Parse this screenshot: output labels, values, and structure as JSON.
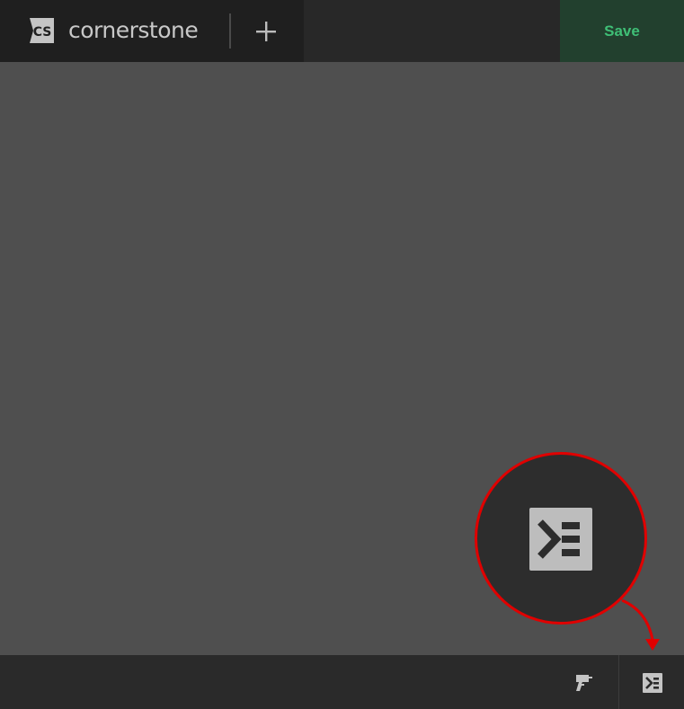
{
  "app": {
    "logo_initials": "CS",
    "logo_name": "cornerstone"
  },
  "toolbar": {
    "save_label": "Save"
  },
  "icons": {
    "add": "plus-icon",
    "drill": "drill-icon",
    "console": "console-icon"
  },
  "colors": {
    "accent_green": "#3fbf76",
    "callout_red": "#e00000"
  }
}
